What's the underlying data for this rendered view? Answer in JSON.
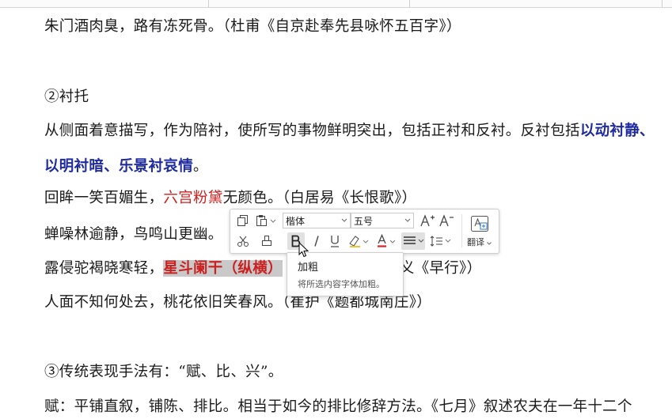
{
  "doc": {
    "line1": "朱门酒肉臭，路有冻死骨。（杜甫《自京赴奉先县咏怀五百字》）",
    "heading2": "②衬托",
    "para_a_text": "从侧面着意描写，作为陪衬，使所写的事物鲜明突出，包括正衬和反衬。反衬包括",
    "para_a_bold": "以动衬静、",
    "para_b_bold": "以明衬暗、乐景衬哀情",
    "para_b_end": "。",
    "poem1_a": "回眸一笑百媚生，",
    "poem1_red": "六宫粉黛",
    "poem1_b": "无颜色。（白居易《长恨歌》）",
    "poem2": "蝉噪林逾静，鸟鸣山更幽。",
    "poem3_a": "露侵驼褐晓寒轻，",
    "poem3_red": "星斗阑干（纵横）",
    "poem3_c": "义《早行》）",
    "poem4": "人面不知何处去，桃花依旧笑春风。（崔护《题都城南庄》）",
    "heading3": "③传统表现手法有：“赋、比、兴”。",
    "para_c": "赋：平铺直叙，铺陈、排比。相当于如今的排比修辞方法。《七月》叙述农夫在一年十二个"
  },
  "toolbar": {
    "font_name": "楷体",
    "font_size": "五号",
    "translate_label": "翻译"
  },
  "tooltip": {
    "title": "加粗",
    "description": "将所选内容字体加粗。"
  },
  "colors": {
    "bold_blue": "#1f2b9e",
    "red": "#cc1f1f",
    "font_color_underline": "#e02020",
    "selection": "#c9c9c9"
  }
}
